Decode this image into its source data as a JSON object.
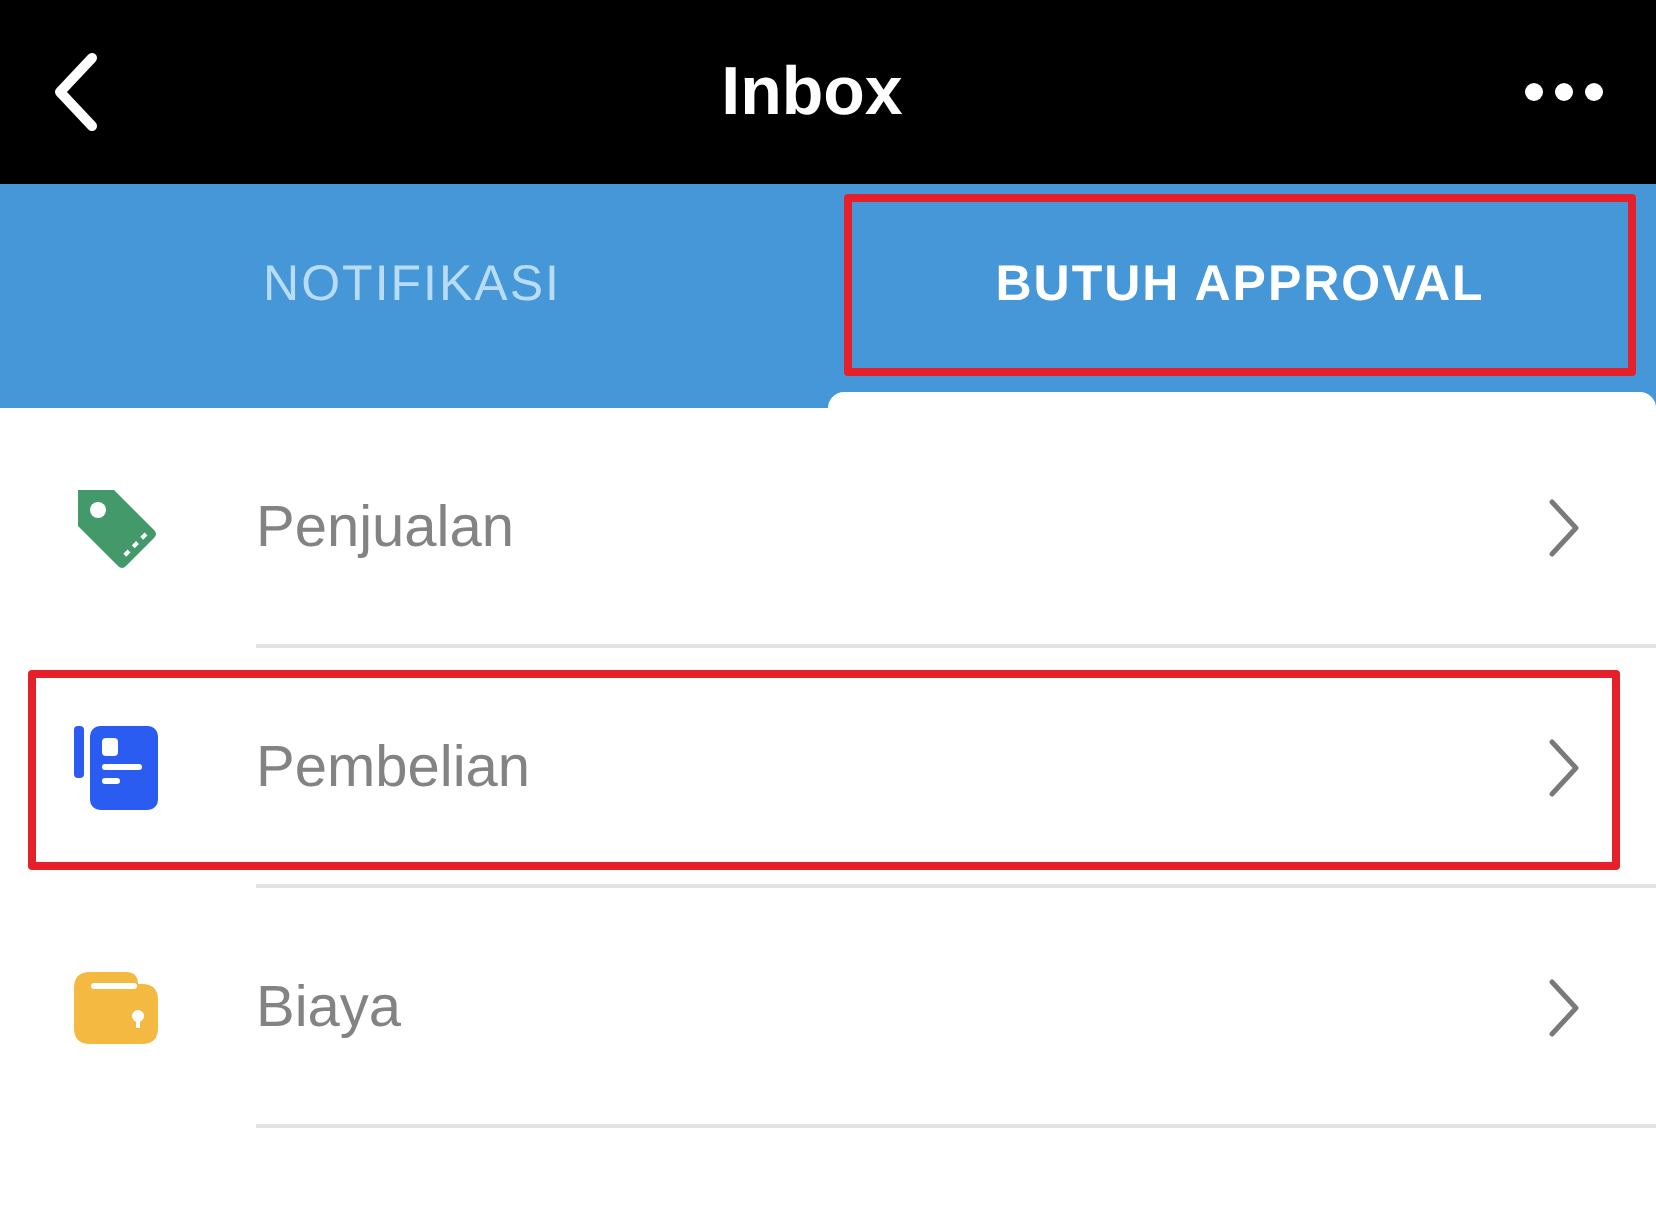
{
  "header": {
    "title": "Inbox"
  },
  "tabs": [
    {
      "label": "NOTIFIKASI",
      "selected": false,
      "highlighted": false
    },
    {
      "label": "BUTUH APPROVAL",
      "selected": true,
      "highlighted": true
    }
  ],
  "items": [
    {
      "label": "Penjualan",
      "highlighted": false
    },
    {
      "label": "Pembelian",
      "highlighted": true
    },
    {
      "label": "Biaya",
      "highlighted": false
    }
  ]
}
